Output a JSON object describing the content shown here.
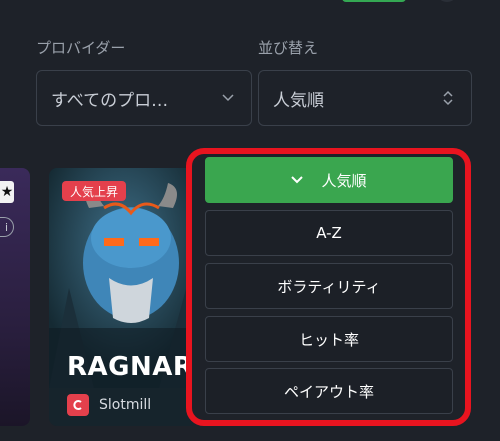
{
  "filters": {
    "provider_label": "プロバイダー",
    "provider_value": "すべてのプロ…",
    "sort_label": "並び替え",
    "sort_value": "人気順"
  },
  "game_card": {
    "badge": "人気上昇",
    "title": "RAGNAROI",
    "provider": "Slotmill"
  },
  "sort_options": [
    {
      "label": "人気順",
      "selected": true
    },
    {
      "label": "A-Z",
      "selected": false
    },
    {
      "label": "ボラティリティ",
      "selected": false
    },
    {
      "label": "ヒット率",
      "selected": false
    },
    {
      "label": "ペイアウト率",
      "selected": false
    }
  ],
  "colors": {
    "background": "#1e2229",
    "selected": "#3aa64f",
    "highlight_border": "#e8141f",
    "badge": "#e4404c"
  }
}
